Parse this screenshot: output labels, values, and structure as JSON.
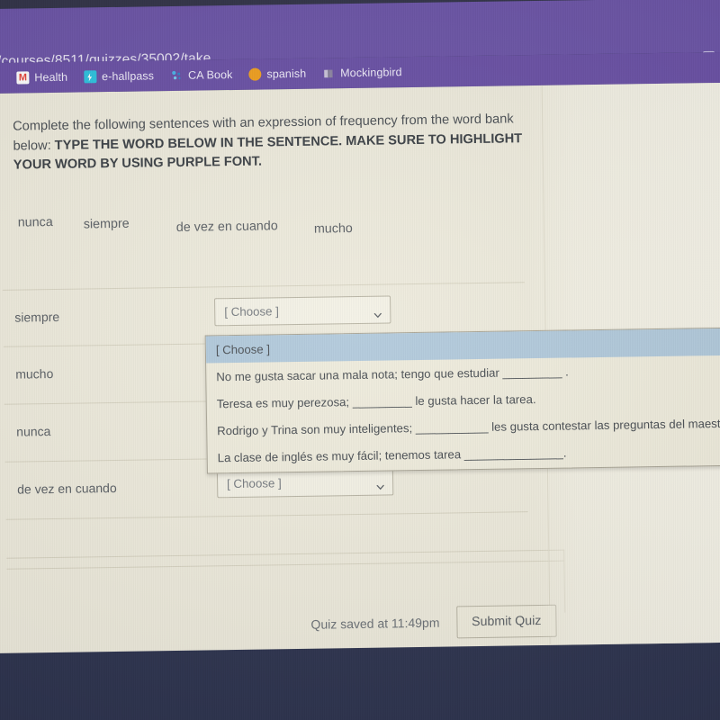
{
  "browser": {
    "url": "/courses/8511/quizzes/35002/take",
    "external_link_icon": "external-link-icon",
    "bookmarks": [
      {
        "label": "",
        "icon": "favicon-partial"
      },
      {
        "label": "Health",
        "icon": "gmail-m-icon"
      },
      {
        "label": "e-hallpass",
        "icon": "e-hallpass-icon"
      },
      {
        "label": "CA Book",
        "icon": "ca-book-icon"
      },
      {
        "label": "spanish",
        "icon": "orange-dot-icon"
      },
      {
        "label": "Mockingbird",
        "icon": "book-icon"
      }
    ]
  },
  "quiz": {
    "prompt_normal": "Complete the following sentences with an expression of frequency from the word bank below: ",
    "prompt_bold": "TYPE THE WORD BELOW IN THE SENTENCE. MAKE SURE TO HIGHLIGHT YOUR WORD BY USING PURPLE FONT.",
    "word_bank": [
      "nunca",
      "siempre",
      "de vez en cuando",
      "mucho"
    ],
    "rows": [
      {
        "label": "siempre",
        "select_value": "[ Choose ]"
      },
      {
        "label": "mucho",
        "select_value": "[ Choose ]"
      },
      {
        "label": "nunca",
        "select_value": "[ Choose ]"
      },
      {
        "label": "de vez en cuando",
        "select_value": "[ Choose ]"
      }
    ],
    "open_dropdown": {
      "row_index": 0,
      "options": [
        "[ Choose ]",
        "No me gusta sacar una mala nota; tengo que estudiar _________ .",
        "Teresa es muy perezosa; _________ le gusta hacer la tarea.",
        "Rodrigo y Trina son muy inteligentes; ___________ les gusta contestar las preguntas del maestro.",
        "La clase de inglés es muy fácil; tenemos tarea _______________."
      ],
      "selected_index": 0
    },
    "saved_status": "Quiz saved at 11:49pm",
    "submit_label": "Submit Quiz"
  },
  "colors": {
    "browser_purple": "#6b52a6",
    "url_bar_purple": "#6d56a8",
    "page_bg": "#eeebdd",
    "highlight_blue": "#b2cadc",
    "desktop_navy": "#2f3550"
  }
}
